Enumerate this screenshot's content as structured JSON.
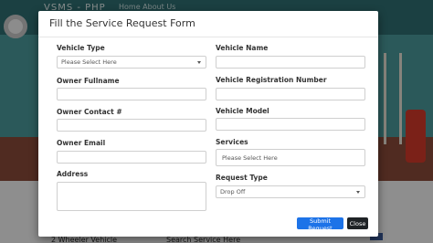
{
  "background": {
    "brand": "VSMS - PHP",
    "nav_links": "Home  About Us",
    "bottom_left": "2 Wheeler Vehicle",
    "bottom_right": "Search Service Here"
  },
  "modal": {
    "title": "Fill the Service Request Form",
    "fields": {
      "vehicle_type": {
        "label": "Vehicle Type",
        "value": "Please Select Here"
      },
      "vehicle_name": {
        "label": "Vehicle Name",
        "value": ""
      },
      "owner_fullname": {
        "label": "Owner Fullname",
        "value": ""
      },
      "vehicle_registration_number": {
        "label": "Vehicle Registration Number",
        "value": ""
      },
      "owner_contact": {
        "label": "Owner Contact #",
        "value": ""
      },
      "vehicle_model": {
        "label": "Vehicle Model",
        "value": ""
      },
      "owner_email": {
        "label": "Owner Email",
        "value": ""
      },
      "services": {
        "label": "Services",
        "value": "Please Select Here"
      },
      "address": {
        "label": "Address",
        "value": ""
      },
      "request_type": {
        "label": "Request Type",
        "value": "Drop Off"
      }
    },
    "buttons": {
      "submit": "Submit Request",
      "close": "Close"
    }
  },
  "colors": {
    "submit_button": "#1d73e8",
    "close_button": "#1f2326"
  }
}
